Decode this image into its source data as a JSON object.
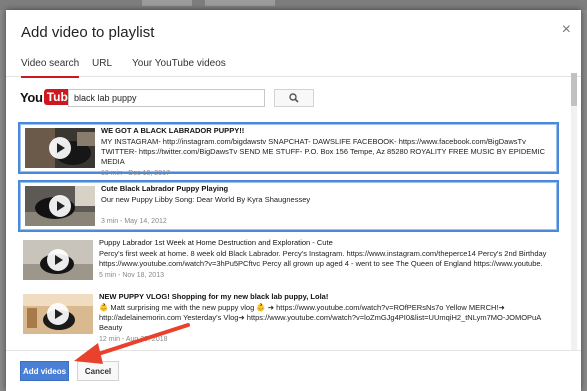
{
  "dialog": {
    "title": "Add video to playlist",
    "close_icon": "×"
  },
  "tabs": [
    {
      "label": "Video search",
      "active": true
    },
    {
      "label": "URL",
      "active": false
    },
    {
      "label": "Your YouTube videos",
      "active": false
    }
  ],
  "logo": {
    "you": "You",
    "tube": "Tube"
  },
  "search": {
    "value": "black lab puppy",
    "icon": "search-icon"
  },
  "results": [
    {
      "title": "WE GOT A BLACK LABRADOR PUPPY!!",
      "description": "MY INSTAGRAM- http://instagram.com/bigdawstv SNAPCHAT- DAWSLIFE FACEBOOK- https://www.facebook.com/BigDawsTv TWITTER- https://twitter.com/BigDawsTv SEND ME STUFF- P.O. Box 156 Tempe, Az 85280 ROYALITY FREE MUSIC BY EPIDEMIC MEDIA",
      "meta": "18 min - Dec 18, 2017",
      "selected": true
    },
    {
      "title": "Cute Black Labrador Puppy Playing",
      "description": "Our new Puppy Libby Song: Dear World By Kyra Shaugnessey",
      "meta": "3 min - May 14, 2012",
      "selected": true
    },
    {
      "title": "Puppy Labrador 1st Week at Home Destruction and Exploration - Cute",
      "description": "Percy's first week at home. 8 week old Black Labrador. Percy's Instagram. https://www.instagram.com/theperce14 Percy's 2nd Birthday https://www.youtube.com/watch?v=3hPu5PCftvc Percy all grown up aged 4 - went to see The Queen of England https://www.youtube.",
      "meta": "5 min - Nov 18, 2013",
      "selected": false
    },
    {
      "title": "NEW PUPPY VLOG! Shopping for my new black lab puppy, Lola!",
      "description": "👶 Matt surprising me with the new puppy vlog 👶 ➜ https://www.youtube.com/watch?v=ROfPERsNs7o Yellow MERCH!➜ http://adelainemorin.com Yesterday's Vlog➜ https://www.youtube.com/watch?v=loZmGJg4PI0&list=UUmqiH2_tNLym7MO-JOMOPuA Beauty",
      "meta": "12 min - Aug 29, 2018",
      "selected": false
    }
  ],
  "footer": {
    "add_label": "Add videos",
    "cancel_label": "Cancel"
  },
  "colors": {
    "accent": "#cc181e",
    "selection": "#4a89dc",
    "primary_button": "#4a7fd6",
    "annotation_arrow": "#e8412c"
  }
}
